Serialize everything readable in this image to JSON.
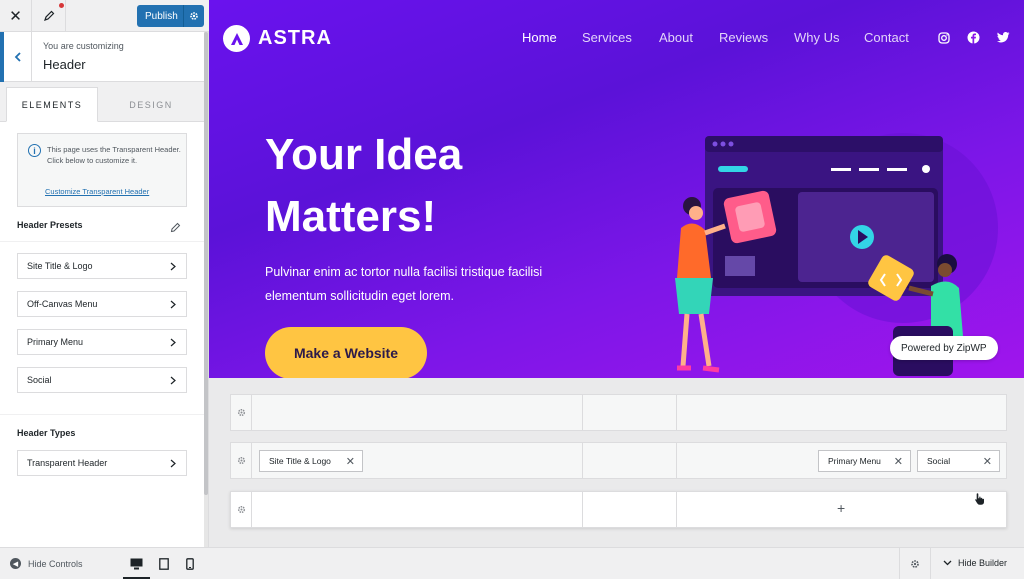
{
  "topbar": {
    "publish_label": "Publish"
  },
  "customizing": {
    "label": "You are customizing",
    "title": "Header"
  },
  "tabs": [
    {
      "label": "ELEMENTS"
    },
    {
      "label": "DESIGN"
    }
  ],
  "notice": {
    "text": "This page uses the Transparent Header. Click below to customize it.",
    "link": "Customize Transparent Header"
  },
  "presets": {
    "title": "Header Presets",
    "items": [
      {
        "label": "Site Title & Logo"
      },
      {
        "label": "Off-Canvas Menu"
      },
      {
        "label": "Primary Menu"
      },
      {
        "label": "Social"
      }
    ]
  },
  "types": {
    "title": "Header Types",
    "items": [
      {
        "label": "Transparent Header"
      }
    ]
  },
  "bottombar": {
    "hide_controls": "Hide Controls"
  },
  "site": {
    "logo_text": "ASTRA",
    "nav": [
      {
        "label": "Home"
      },
      {
        "label": "Services"
      },
      {
        "label": "About"
      },
      {
        "label": "Reviews"
      },
      {
        "label": "Why Us"
      },
      {
        "label": "Contact"
      }
    ],
    "social_icons": [
      "instagram-icon",
      "facebook-icon",
      "twitter-icon"
    ],
    "hero_title": "Your Idea Matters!",
    "hero_desc": "Pulvinar enim ac tortor nulla facilisi tristique facilisi elementum sollicitudin eget lorem.",
    "cta": "Make a Website",
    "badge": "Powered by ZipWP",
    "colors": {
      "accent": "#ffc542",
      "gradient_start": "#6a12ee",
      "gradient_end": "#a015ec",
      "wp_blue": "#2271b1"
    }
  },
  "builder": {
    "chips": {
      "site_title": "Site Title & Logo",
      "primary_menu": "Primary Menu",
      "social": "Social"
    },
    "plus": "+",
    "hide_builder": "Hide Builder"
  }
}
